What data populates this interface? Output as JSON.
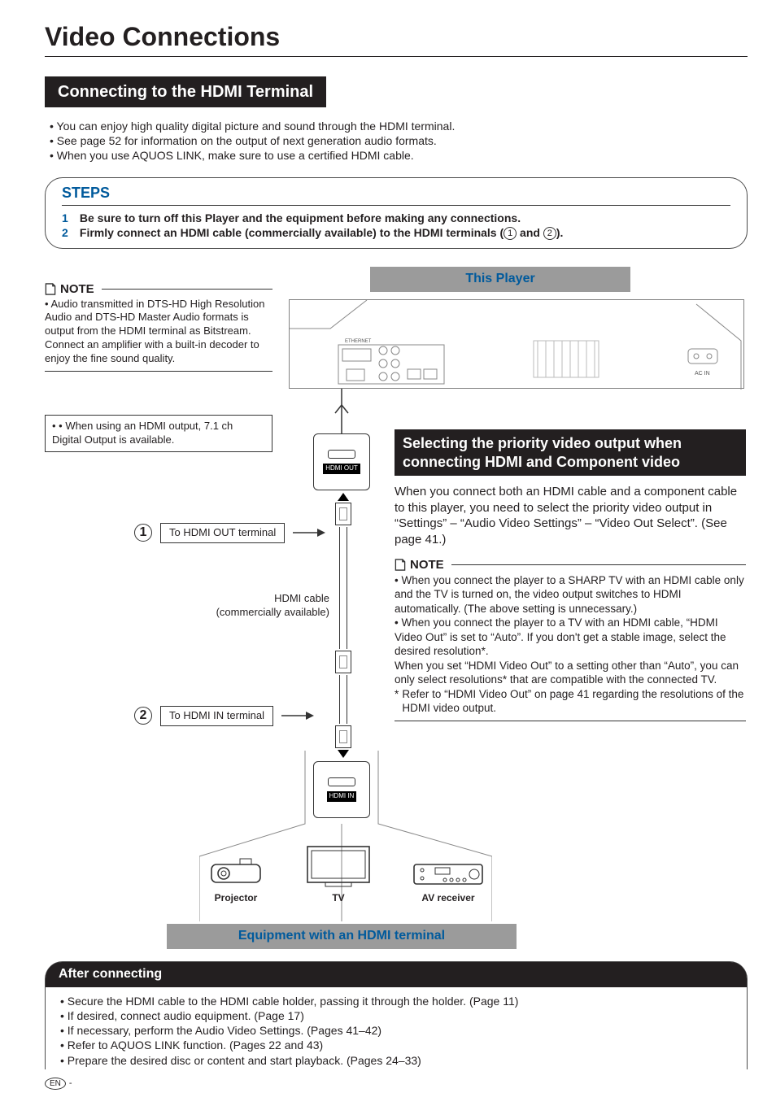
{
  "page_title": "Video Connections",
  "section_heading": "Connecting to the HDMI Terminal",
  "intro_bullets": [
    "You can enjoy high quality digital picture and sound through the HDMI terminal.",
    "See page 52 for information on the output of next generation audio formats.",
    "When you use AQUOS LINK, make sure to use a certified HDMI cable."
  ],
  "steps": {
    "heading": "STEPS",
    "items": [
      {
        "n": "1",
        "text": "Be sure to turn off this Player and the equipment before making any connections."
      },
      {
        "n": "2",
        "text_pre": "Firmly connect an HDMI cable (commercially available) to the HDMI terminals (",
        "c1": "1",
        "mid": " and ",
        "c2": "2",
        "text_post": ")."
      }
    ]
  },
  "this_player_label": "This Player",
  "note1": {
    "label": "NOTE",
    "body": "Audio transmitted in DTS-HD High Resolution Audio and DTS-HD Master Audio formats is output from the HDMI terminal as Bitstream. Connect an amplifier with a built-in decoder to enjoy the fine sound quality."
  },
  "note_hdmi71": "When using an HDMI output, 7.1 ch Digital Output is available.",
  "diagram": {
    "hdmi_out": "HDMI OUT",
    "hdmi_in": "HDMI IN",
    "callout1_n": "1",
    "callout1_text": "To HDMI OUT terminal",
    "callout2_n": "2",
    "callout2_text": "To HDMI IN terminal",
    "cable_label_l1": "HDMI cable",
    "cable_label_l2": "(commercially available)",
    "devices": {
      "projector": "Projector",
      "tv": "TV",
      "av": "AV receiver"
    },
    "equipment_bar": "Equipment with an HDMI terminal"
  },
  "priority": {
    "heading_l1": "Selecting the priority video output when",
    "heading_l2": "connecting HDMI and Component video",
    "para": "When you connect both an HDMI cable and a component cable to this player, you need to select the priority video output in “Settings” – “Audio Video Settings” – “Video Out Select”. (See page 41.)",
    "note_label": "NOTE",
    "notes": [
      "When you connect the player to a SHARP TV with an HDMI cable only and the TV is turned on, the video output switches to HDMI automatically. (The above setting is unnecessary.)",
      "When you connect the player to a TV with an HDMI cable, “HDMI Video Out” is set to “Auto”. If you don't get a stable image, select the desired resolution*.",
      "When you set “HDMI Video Out” to a setting other than “Auto”, you can only select resolutions* that are compatible with the connected TV."
    ],
    "star_text": "Refer to “HDMI Video Out” on page 41 regarding the resolutions of the HDMI video output."
  },
  "after": {
    "heading": "After connecting",
    "items": [
      "Secure the HDMI cable to the HDMI cable holder, passing it through the holder. (Page 11)",
      "If desired, connect audio equipment. (Page 17)",
      "If necessary, perform the Audio Video Settings. (Pages 41–42)",
      "Refer to AQUOS LINK function. (Pages 22 and 43)",
      "Prepare the desired disc or content and start playback. (Pages 24–33)"
    ]
  },
  "footer_lang": "EN"
}
